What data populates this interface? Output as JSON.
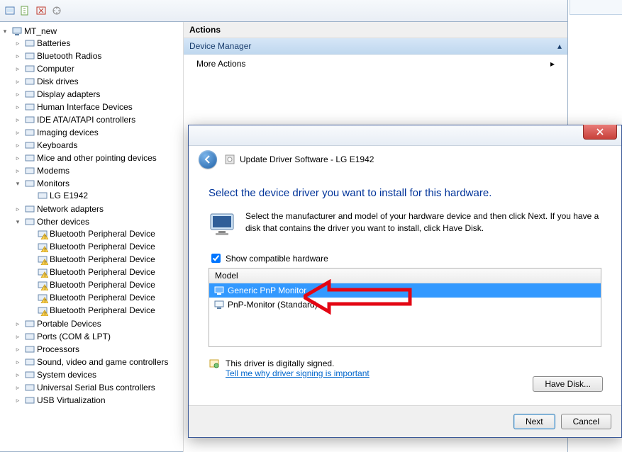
{
  "toolbar_icons": [
    "nav-back",
    "nav-fwd",
    "action",
    "refresh",
    "help"
  ],
  "tree": {
    "root": "MT_new",
    "items": [
      {
        "label": "Batteries"
      },
      {
        "label": "Bluetooth Radios"
      },
      {
        "label": "Computer"
      },
      {
        "label": "Disk drives"
      },
      {
        "label": "Display adapters"
      },
      {
        "label": "Human Interface Devices"
      },
      {
        "label": "IDE ATA/ATAPI controllers"
      },
      {
        "label": "Imaging devices"
      },
      {
        "label": "Keyboards"
      },
      {
        "label": "Mice and other pointing devices"
      },
      {
        "label": "Modems"
      },
      {
        "label": "Monitors",
        "expanded": true,
        "children": [
          {
            "label": "LG E1942"
          }
        ]
      },
      {
        "label": "Network adapters"
      },
      {
        "label": "Other devices",
        "expanded": true,
        "children": [
          {
            "label": "Bluetooth Peripheral Device"
          },
          {
            "label": "Bluetooth Peripheral Device"
          },
          {
            "label": "Bluetooth Peripheral Device"
          },
          {
            "label": "Bluetooth Peripheral Device"
          },
          {
            "label": "Bluetooth Peripheral Device"
          },
          {
            "label": "Bluetooth Peripheral Device"
          },
          {
            "label": "Bluetooth Peripheral Device"
          }
        ]
      },
      {
        "label": "Portable Devices"
      },
      {
        "label": "Ports (COM & LPT)"
      },
      {
        "label": "Processors"
      },
      {
        "label": "Sound, video and game controllers"
      },
      {
        "label": "System devices"
      },
      {
        "label": "Universal Serial Bus controllers"
      },
      {
        "label": "USB Virtualization"
      }
    ]
  },
  "actions": {
    "header": "Actions",
    "group": "Device Manager",
    "item": "More Actions"
  },
  "dialog": {
    "title": "Update Driver Software - LG E1942",
    "heading": "Select the device driver you want to install for this hardware.",
    "instruction": "Select the manufacturer and model of your hardware device and then click Next. If you have a disk that contains the driver you want to install, click Have Disk.",
    "show_compat": "Show compatible hardware",
    "model_header": "Model",
    "models": [
      {
        "label": "Generic PnP Monitor",
        "selected": true
      },
      {
        "label": "PnP-Monitor (Standard)"
      }
    ],
    "signed": "This driver is digitally signed.",
    "why_link": "Tell me why driver signing is important",
    "have_disk": "Have Disk...",
    "next": "Next",
    "cancel": "Cancel"
  }
}
